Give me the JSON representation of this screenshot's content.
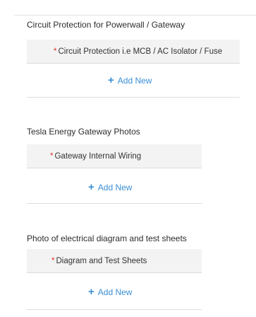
{
  "sections": [
    {
      "title": "Circuit Protection for Powerwall / Gateway",
      "field_label": "Circuit Protection i.e MCB / AC Isolator / Fuse",
      "required_mark": "*",
      "add_label": "Add New"
    },
    {
      "title": "Tesla Energy Gateway Photos",
      "field_label": "Gateway Internal Wiring",
      "required_mark": "*",
      "add_label": "Add New"
    },
    {
      "title": "Photo of electrical diagram and test sheets",
      "field_label": "Diagram and Test Sheets",
      "required_mark": "*",
      "add_label": "Add New"
    }
  ],
  "colors": {
    "accent": "#3b8fd6",
    "required": "#d9352b",
    "row_bg": "#f3f3f3"
  }
}
